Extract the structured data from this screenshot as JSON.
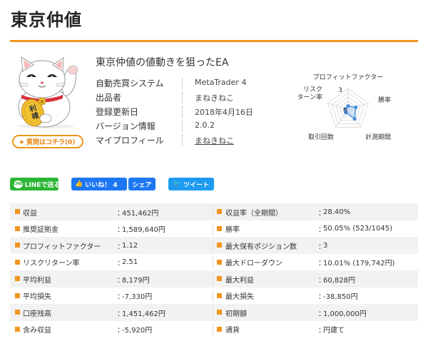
{
  "page": {
    "title": "東京仲値"
  },
  "mascot": {
    "alt": "まねきねこ",
    "coin_text": "利確",
    "collar_tag_text": "福",
    "question_button": "質問はコチラ(0)"
  },
  "ea": {
    "headline": "東京仲値の値動きを狙ったEA",
    "specs": [
      {
        "key": "自動売買システム",
        "value": "MetaTrader 4",
        "link": false
      },
      {
        "key": "出品者",
        "value": "まねきねこ",
        "link": false
      },
      {
        "key": "登録更新日",
        "value": "2018年4月16日",
        "link": false
      },
      {
        "key": "バージョン情報",
        "value": "2.0.2",
        "link": false
      },
      {
        "key": "マイプロフィール",
        "value": "まねきねこ",
        "link": true
      }
    ]
  },
  "chart_data": {
    "type": "radar",
    "axes": [
      "プロフィットファクター",
      "勝率",
      "計測期間",
      "取引回数",
      "リスク\nターン率"
    ],
    "axis_label_lines": [
      [
        "プロフィットファクター"
      ],
      [
        "勝率"
      ],
      [
        "計測期間"
      ],
      [
        "取引回数"
      ],
      [
        "リスク",
        "ターン率"
      ]
    ],
    "scale_labels": [
      "3",
      "0"
    ],
    "scale_max": 5,
    "values": [
      0.9,
      1.9,
      2.6,
      0.8,
      0.7
    ],
    "rings": 5,
    "series_color": "#4a90d9",
    "fill_color": "#a9cdee",
    "grid_color": "#cfcfcf"
  },
  "social": {
    "line_badge": "LINE",
    "line_label": "LINEで送る",
    "like_label": "いいね！ 4",
    "share_label": "シェア",
    "tweet_label": "ツイート"
  },
  "stats": {
    "separator": "：",
    "rows": [
      [
        {
          "label": "収益",
          "value": "451,462円"
        },
        {
          "label": "収益率（全期間）",
          "value": "28.40%"
        }
      ],
      [
        {
          "label": "推奨証拠金",
          "value": "1,589,640円"
        },
        {
          "label": "勝率",
          "value": "50.05% (523/1045)"
        }
      ],
      [
        {
          "label": "プロフィットファクター",
          "value": "1.12"
        },
        {
          "label": "最大保有ポジション数",
          "value": "3"
        }
      ],
      [
        {
          "label": "リスクリターン率",
          "value": "2.51"
        },
        {
          "label": "最大ドローダウン",
          "value": "10.01% (179,742円)"
        }
      ],
      [
        {
          "label": "平均利益",
          "value": "8,179円"
        },
        {
          "label": "最大利益",
          "value": "60,828円"
        }
      ],
      [
        {
          "label": "平均損失",
          "value": "-7,330円"
        },
        {
          "label": "最大損失",
          "value": "-38,850円"
        }
      ],
      [
        {
          "label": "口座残高",
          "value": "1,451,462円"
        },
        {
          "label": "初期額",
          "value": "1,000,000円"
        }
      ],
      [
        {
          "label": "含み収益",
          "value": "-5,920円"
        },
        {
          "label": "通貨",
          "value": "円建て"
        }
      ]
    ]
  },
  "colors": {
    "accent": "#f0961e",
    "stripe": "#f2f2f2"
  }
}
